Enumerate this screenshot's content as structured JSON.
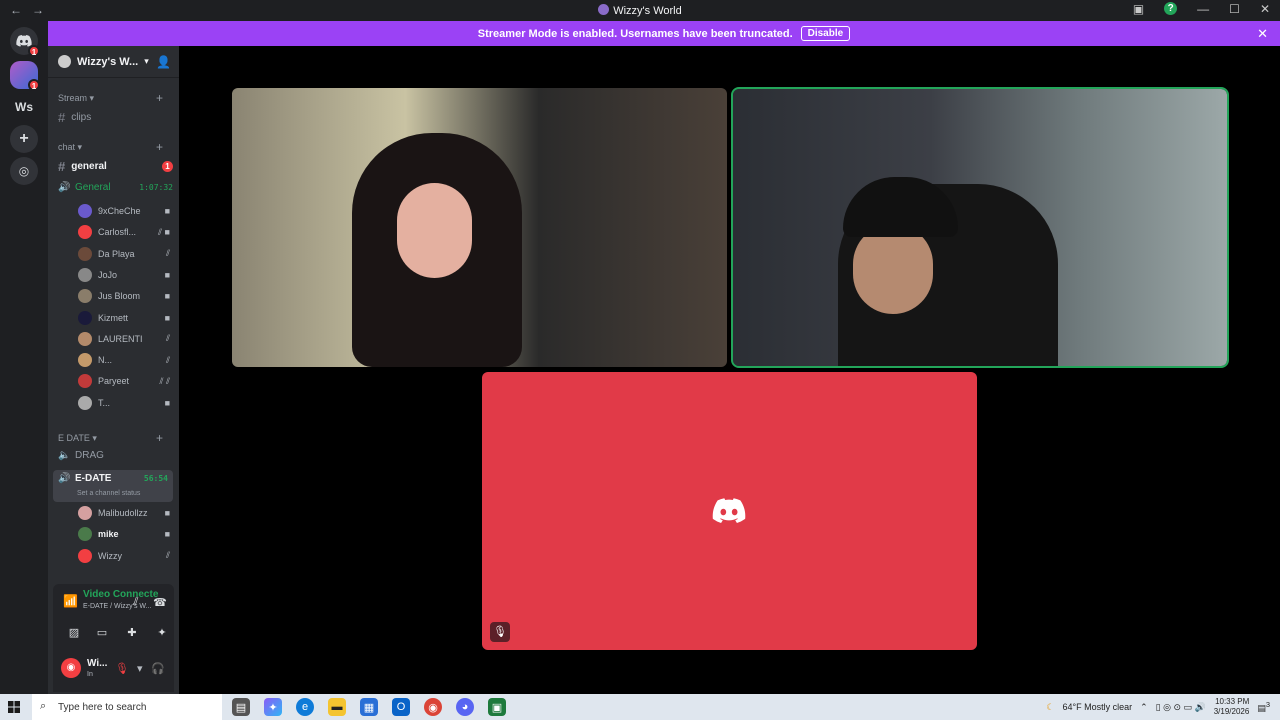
{
  "window": {
    "title": "Wizzy's World",
    "back": "←",
    "forward": "→",
    "minimize": "—",
    "maximize": "☐",
    "close": "✕",
    "help": "?"
  },
  "rail": {
    "home_badge": "1",
    "server_badge": "1",
    "ws_label": "Ws"
  },
  "banner": {
    "text": "Streamer Mode is enabled. Usernames have been truncated.",
    "button": "Disable"
  },
  "server": {
    "name": "Wizzy's W..."
  },
  "categories": {
    "stream": "Stream",
    "chat": "chat",
    "edate": "E DATE"
  },
  "channels": {
    "clips": "clips",
    "general": "general",
    "general_unread": "1",
    "general_voice": "General",
    "general_timer": "1:07:32",
    "drag": "DRAG",
    "edate": "E-DATE",
    "edate_timer": "56:54",
    "edate_status": "Set a channel status"
  },
  "general_users": [
    {
      "name": "9xCheChe",
      "color": "#6a5acd"
    },
    {
      "name": "Carlosfl...",
      "color": "#f23f42"
    },
    {
      "name": "Da Playa",
      "color": "#6b4a3a"
    },
    {
      "name": "JoJo",
      "color": "#888888"
    },
    {
      "name": "Jus Bloom",
      "color": "#8a7d6a"
    },
    {
      "name": "Kizmett",
      "color": "#1a1a3a"
    },
    {
      "name": "LAURENTI",
      "color": "#b38a6a"
    },
    {
      "name": "N...",
      "color": "#c49a6a"
    },
    {
      "name": "Paryeet",
      "color": "#c23a3a"
    },
    {
      "name": "T...",
      "color": "#aaaaaa"
    }
  ],
  "edate_users": [
    {
      "name": "Malibudollzz",
      "color": "#d4a0a0"
    },
    {
      "name": "mike",
      "color": "#4a7a4a"
    },
    {
      "name": "Wizzy",
      "color": "#f23f42"
    }
  ],
  "voice_panel": {
    "status": "Video Connecte",
    "location": "E-DATE / Wizzy's W..."
  },
  "user_panel": {
    "name": "Wi...",
    "status": "In"
  },
  "taskbar": {
    "search_placeholder": "Type here to search",
    "weather": "64°F  Mostly clear",
    "time": "10:33 PM",
    "date": "3/19/2026",
    "notif": "3"
  },
  "colors": {
    "accent_green": "#23a55a",
    "banner": "#9b42f5",
    "tile_red": "#e13a48",
    "unread": "#f23f42"
  }
}
